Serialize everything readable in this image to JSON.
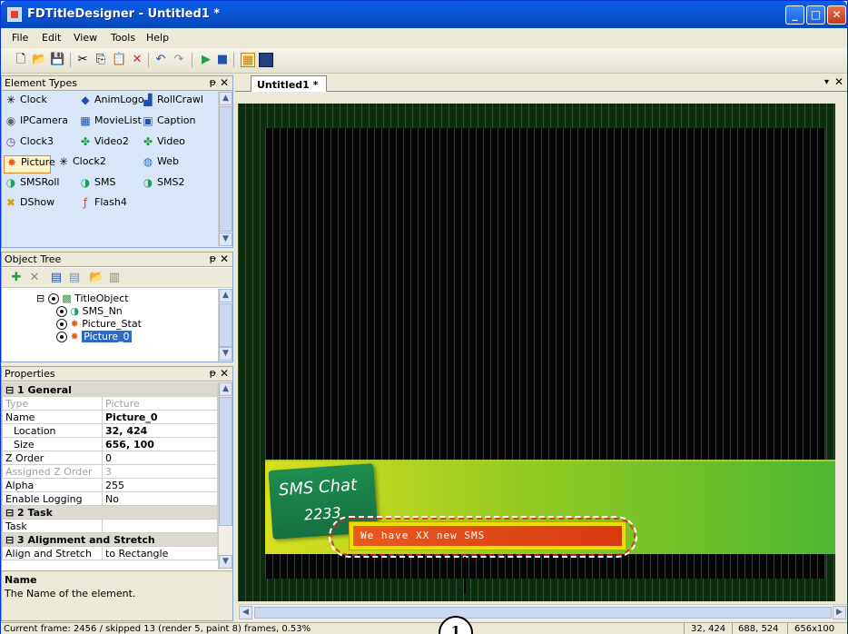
{
  "window": {
    "title": "FDTitleDesigner - Untitled1 *"
  },
  "menubar": [
    "File",
    "Edit",
    "View",
    "Tools",
    "Help"
  ],
  "element_types": {
    "title": "Element Types",
    "items": [
      {
        "label": "Clock",
        "icon": "clock-icon"
      },
      {
        "label": "AnimLogo",
        "icon": "animlogo-icon"
      },
      {
        "label": "RollCrawl",
        "icon": "rollcrawl-icon"
      },
      {
        "label": "IPCamera",
        "icon": "ipcamera-icon"
      },
      {
        "label": "MovieList",
        "icon": "movielist-icon"
      },
      {
        "label": "Caption",
        "icon": "caption-icon"
      },
      {
        "label": "Clock3",
        "icon": "clock3-icon"
      },
      {
        "label": "Video2",
        "icon": "video2-icon"
      },
      {
        "label": "Video",
        "icon": "video-icon"
      },
      {
        "label": "Picture",
        "icon": "picture-icon",
        "selected": true
      },
      {
        "label": "Clock2",
        "icon": "clock2-icon"
      },
      {
        "label": "Web",
        "icon": "web-icon"
      },
      {
        "label": "SMSRoll",
        "icon": "smsroll-icon"
      },
      {
        "label": "SMS",
        "icon": "sms-icon"
      },
      {
        "label": "SMS2",
        "icon": "sms2-icon"
      },
      {
        "label": "DShow",
        "icon": "dshow-icon"
      },
      {
        "label": "Flash4",
        "icon": "flash-icon"
      }
    ]
  },
  "object_tree": {
    "title": "Object Tree",
    "nodes": [
      {
        "label": "TitleObject"
      },
      {
        "label": "SMS_Nn"
      },
      {
        "label": "Picture_Stat"
      },
      {
        "label": "Picture_0",
        "selected": true
      }
    ]
  },
  "properties": {
    "title": "Properties",
    "rows": [
      {
        "cat": true,
        "name": "1 General"
      },
      {
        "name": "Type",
        "value": "Picture",
        "dim": true
      },
      {
        "name": "Name",
        "value": "Picture_0",
        "bold": true
      },
      {
        "name": "Location",
        "value": "32, 424",
        "expand": true,
        "bold": true
      },
      {
        "name": "Size",
        "value": "656, 100",
        "expand": true,
        "bold": true
      },
      {
        "name": "Z Order",
        "value": "0"
      },
      {
        "name": "Assigned Z Order",
        "value": "3",
        "dim": true
      },
      {
        "name": "Alpha",
        "value": "255"
      },
      {
        "name": "Enable Logging",
        "value": "No"
      },
      {
        "cat": true,
        "name": "2 Task"
      },
      {
        "name": "Task",
        "value": ""
      },
      {
        "cat": true,
        "name": "3 Alignment and Stretch"
      },
      {
        "name": "Align and Stretch",
        "value": "to Rectangle"
      }
    ],
    "description_title": "Name",
    "description_text": "The Name of the element."
  },
  "document": {
    "tab": "Untitled1 *",
    "banner_title": "SMS Chat",
    "banner_number": "2233",
    "message": "We have  XX  new SMS"
  },
  "statusbar": {
    "frame_info": "Current frame: 2456 / skipped 13 (render 5, paint 8) frames, 0.53%",
    "location": "32, 424",
    "cursor": "688, 524",
    "size": "656x100"
  },
  "callout": "1"
}
